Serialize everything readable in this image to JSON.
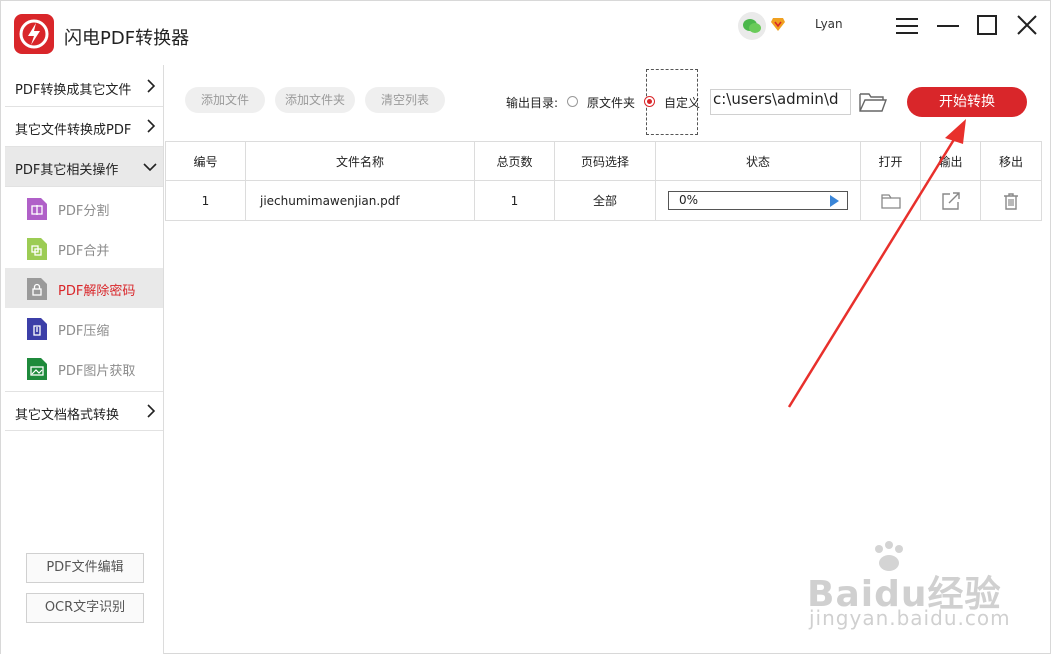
{
  "app": {
    "title": "闪电PDF转换器",
    "username": "Lyan"
  },
  "sidebar": {
    "groups": [
      {
        "label": "PDF转换成其它文件"
      },
      {
        "label": "其它文件转换成PDF"
      },
      {
        "label": "PDF其它相关操作"
      },
      {
        "label": "其它文档格式转换"
      }
    ],
    "items": [
      {
        "label": "PDF分割",
        "icon": "split-icon",
        "color": "#b060c8"
      },
      {
        "label": "PDF合并",
        "icon": "merge-icon",
        "color": "#9ccc54"
      },
      {
        "label": "PDF解除密码",
        "icon": "unlock-icon",
        "color": "#9a9a9a"
      },
      {
        "label": "PDF压缩",
        "icon": "compress-icon",
        "color": "#3c3fa8"
      },
      {
        "label": "PDF图片获取",
        "icon": "image-extract-icon",
        "color": "#1f8a3c"
      }
    ],
    "bottom_buttons": [
      "PDF文件编辑",
      "OCR文字识别"
    ]
  },
  "toolbar": {
    "add_file": "添加文件",
    "add_folder": "添加文件夹",
    "clear_list": "清空列表",
    "output_label": "输出目录:",
    "option_original": "原文件夹",
    "option_custom": "自定义",
    "output_path": "c:\\users\\admin\\d",
    "start": "开始转换"
  },
  "table": {
    "headers": [
      "编号",
      "文件名称",
      "总页数",
      "页码选择",
      "状态",
      "打开",
      "输出",
      "移出"
    ],
    "rows": [
      {
        "index": "1",
        "name": "jiechumimawenjian.pdf",
        "pages": "1",
        "range": "全部",
        "status": "0%"
      }
    ]
  },
  "colors": {
    "accent": "#d9262a",
    "progress_play": "#3b86d8"
  },
  "watermark": {
    "brand": "Baidu经验",
    "url": "jingyan.baidu.com"
  }
}
